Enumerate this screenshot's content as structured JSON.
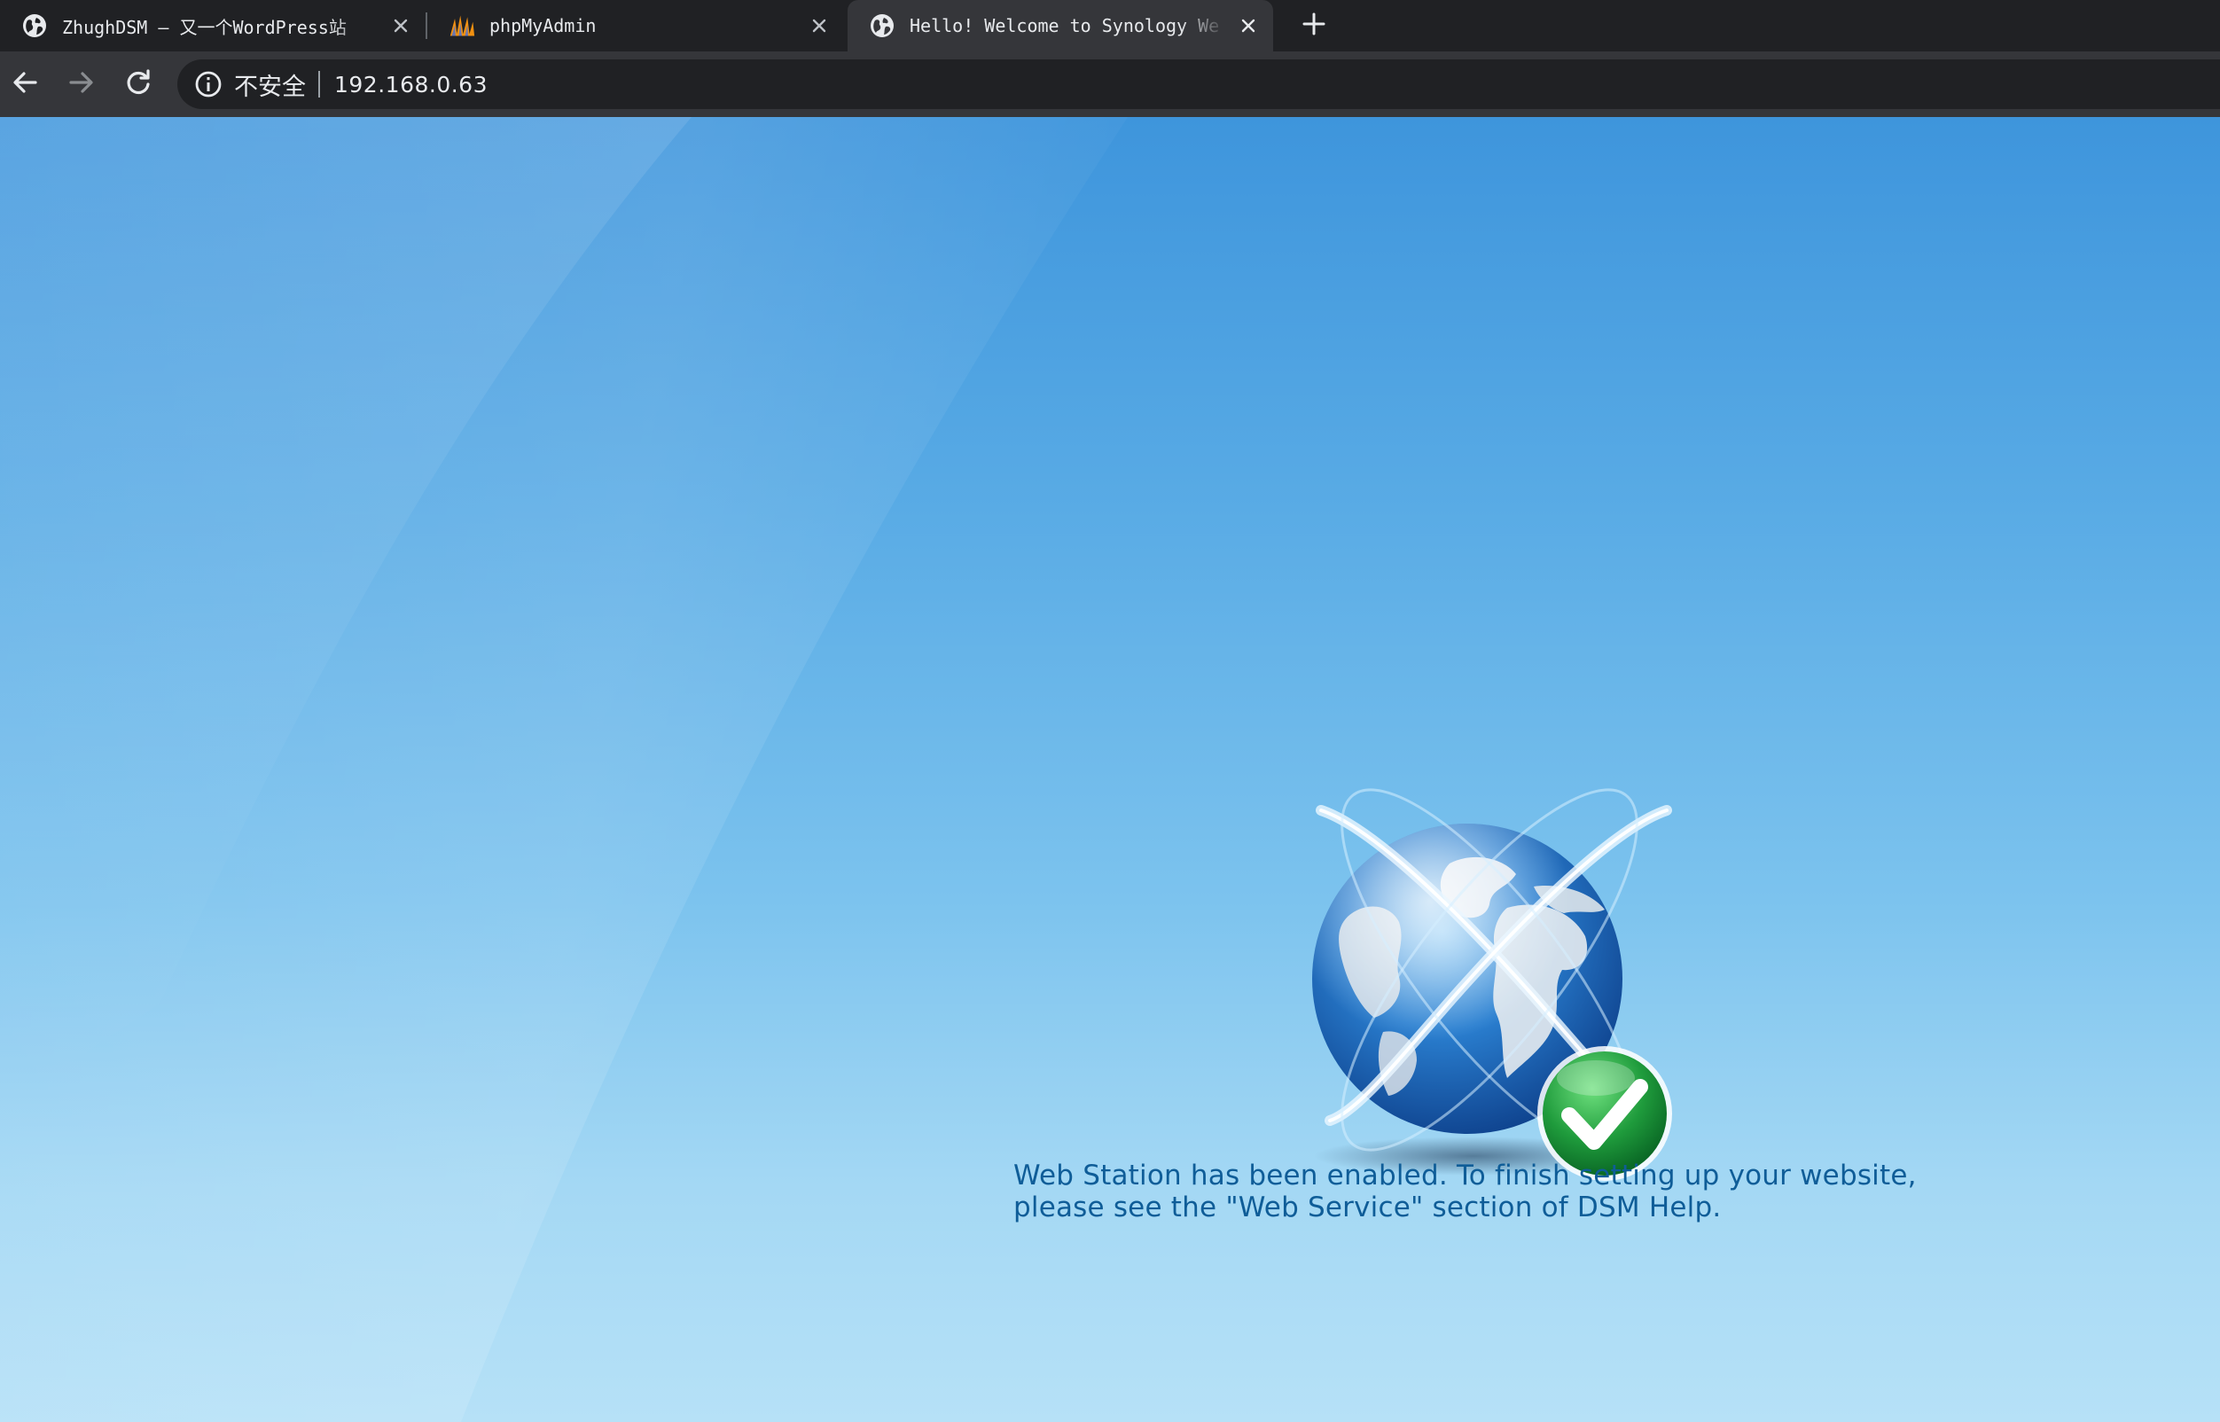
{
  "browser": {
    "tabs": [
      {
        "title": "ZhughDSM – 又一个WordPress站",
        "favicon": "globe-icon",
        "active": false
      },
      {
        "title": "phpMyAdmin",
        "favicon": "phpmyadmin-logo-icon",
        "active": false
      },
      {
        "title": "Hello! Welcome to Synology We",
        "favicon": "globe-icon",
        "active": true
      }
    ],
    "new_tab_icon": "plus-icon"
  },
  "toolbar": {
    "back_icon": "back-arrow-icon",
    "forward_icon": "forward-arrow-icon",
    "reload_icon": "reload-icon",
    "security_icon": "info-circle-icon",
    "security_label": "不安全",
    "url": "192.168.0.63"
  },
  "page": {
    "illustration": "globe-with-orbits-and-checkmark",
    "message_line1": "Web Station has been enabled. To finish setting up your website,",
    "message_line2": "please see the \"Web Service\" section of DSM Help.",
    "text_color": "#0f5d98"
  },
  "colors": {
    "tabstrip_bg": "#202124",
    "toolbar_bg": "#35363a",
    "omnibox_bg": "#202124",
    "page_bg_top": "#3e95dc",
    "page_bg_bottom": "#b6e1f7",
    "check_green": "#2aa84a"
  }
}
